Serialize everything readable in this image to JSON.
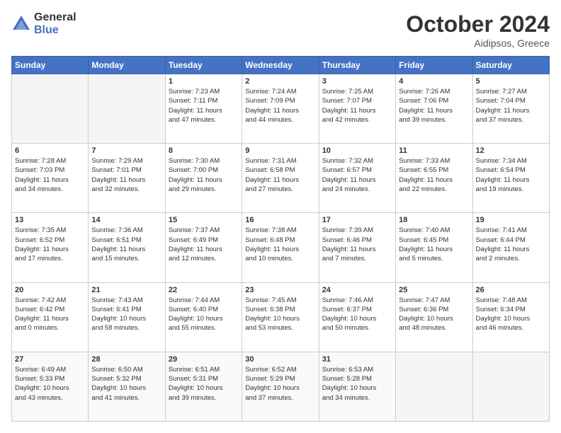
{
  "logo": {
    "line1": "General",
    "line2": "Blue"
  },
  "header": {
    "month": "October 2024",
    "location": "Aidipsos, Greece"
  },
  "weekdays": [
    "Sunday",
    "Monday",
    "Tuesday",
    "Wednesday",
    "Thursday",
    "Friday",
    "Saturday"
  ],
  "weeks": [
    [
      {
        "day": "",
        "info": ""
      },
      {
        "day": "",
        "info": ""
      },
      {
        "day": "1",
        "info": "Sunrise: 7:23 AM\nSunset: 7:11 PM\nDaylight: 11 hours\nand 47 minutes."
      },
      {
        "day": "2",
        "info": "Sunrise: 7:24 AM\nSunset: 7:09 PM\nDaylight: 11 hours\nand 44 minutes."
      },
      {
        "day": "3",
        "info": "Sunrise: 7:25 AM\nSunset: 7:07 PM\nDaylight: 11 hours\nand 42 minutes."
      },
      {
        "day": "4",
        "info": "Sunrise: 7:26 AM\nSunset: 7:06 PM\nDaylight: 11 hours\nand 39 minutes."
      },
      {
        "day": "5",
        "info": "Sunrise: 7:27 AM\nSunset: 7:04 PM\nDaylight: 11 hours\nand 37 minutes."
      }
    ],
    [
      {
        "day": "6",
        "info": "Sunrise: 7:28 AM\nSunset: 7:03 PM\nDaylight: 11 hours\nand 34 minutes."
      },
      {
        "day": "7",
        "info": "Sunrise: 7:29 AM\nSunset: 7:01 PM\nDaylight: 11 hours\nand 32 minutes."
      },
      {
        "day": "8",
        "info": "Sunrise: 7:30 AM\nSunset: 7:00 PM\nDaylight: 11 hours\nand 29 minutes."
      },
      {
        "day": "9",
        "info": "Sunrise: 7:31 AM\nSunset: 6:58 PM\nDaylight: 11 hours\nand 27 minutes."
      },
      {
        "day": "10",
        "info": "Sunrise: 7:32 AM\nSunset: 6:57 PM\nDaylight: 11 hours\nand 24 minutes."
      },
      {
        "day": "11",
        "info": "Sunrise: 7:33 AM\nSunset: 6:55 PM\nDaylight: 11 hours\nand 22 minutes."
      },
      {
        "day": "12",
        "info": "Sunrise: 7:34 AM\nSunset: 6:54 PM\nDaylight: 11 hours\nand 19 minutes."
      }
    ],
    [
      {
        "day": "13",
        "info": "Sunrise: 7:35 AM\nSunset: 6:52 PM\nDaylight: 11 hours\nand 17 minutes."
      },
      {
        "day": "14",
        "info": "Sunrise: 7:36 AM\nSunset: 6:51 PM\nDaylight: 11 hours\nand 15 minutes."
      },
      {
        "day": "15",
        "info": "Sunrise: 7:37 AM\nSunset: 6:49 PM\nDaylight: 11 hours\nand 12 minutes."
      },
      {
        "day": "16",
        "info": "Sunrise: 7:38 AM\nSunset: 6:48 PM\nDaylight: 11 hours\nand 10 minutes."
      },
      {
        "day": "17",
        "info": "Sunrise: 7:39 AM\nSunset: 6:46 PM\nDaylight: 11 hours\nand 7 minutes."
      },
      {
        "day": "18",
        "info": "Sunrise: 7:40 AM\nSunset: 6:45 PM\nDaylight: 11 hours\nand 5 minutes."
      },
      {
        "day": "19",
        "info": "Sunrise: 7:41 AM\nSunset: 6:44 PM\nDaylight: 11 hours\nand 2 minutes."
      }
    ],
    [
      {
        "day": "20",
        "info": "Sunrise: 7:42 AM\nSunset: 6:42 PM\nDaylight: 11 hours\nand 0 minutes."
      },
      {
        "day": "21",
        "info": "Sunrise: 7:43 AM\nSunset: 6:41 PM\nDaylight: 10 hours\nand 58 minutes."
      },
      {
        "day": "22",
        "info": "Sunrise: 7:44 AM\nSunset: 6:40 PM\nDaylight: 10 hours\nand 55 minutes."
      },
      {
        "day": "23",
        "info": "Sunrise: 7:45 AM\nSunset: 6:38 PM\nDaylight: 10 hours\nand 53 minutes."
      },
      {
        "day": "24",
        "info": "Sunrise: 7:46 AM\nSunset: 6:37 PM\nDaylight: 10 hours\nand 50 minutes."
      },
      {
        "day": "25",
        "info": "Sunrise: 7:47 AM\nSunset: 6:36 PM\nDaylight: 10 hours\nand 48 minutes."
      },
      {
        "day": "26",
        "info": "Sunrise: 7:48 AM\nSunset: 6:34 PM\nDaylight: 10 hours\nand 46 minutes."
      }
    ],
    [
      {
        "day": "27",
        "info": "Sunrise: 6:49 AM\nSunset: 5:33 PM\nDaylight: 10 hours\nand 43 minutes."
      },
      {
        "day": "28",
        "info": "Sunrise: 6:50 AM\nSunset: 5:32 PM\nDaylight: 10 hours\nand 41 minutes."
      },
      {
        "day": "29",
        "info": "Sunrise: 6:51 AM\nSunset: 5:31 PM\nDaylight: 10 hours\nand 39 minutes."
      },
      {
        "day": "30",
        "info": "Sunrise: 6:52 AM\nSunset: 5:29 PM\nDaylight: 10 hours\nand 37 minutes."
      },
      {
        "day": "31",
        "info": "Sunrise: 6:53 AM\nSunset: 5:28 PM\nDaylight: 10 hours\nand 34 minutes."
      },
      {
        "day": "",
        "info": ""
      },
      {
        "day": "",
        "info": ""
      }
    ]
  ]
}
